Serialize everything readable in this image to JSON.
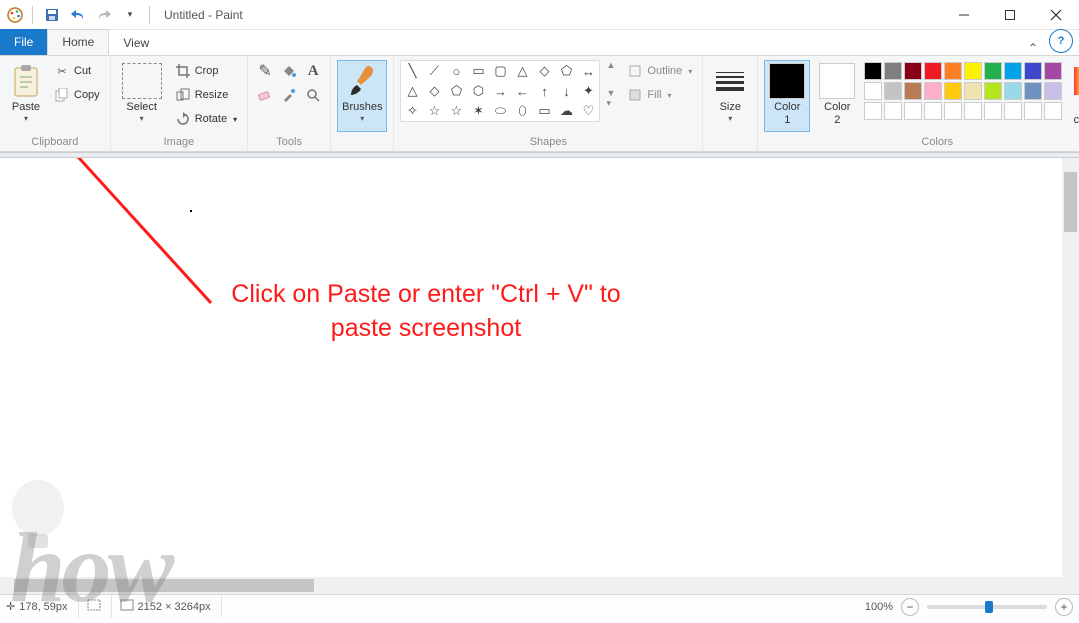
{
  "title": "Untitled - Paint",
  "tabs": {
    "file": "File",
    "home": "Home",
    "view": "View"
  },
  "groups": {
    "clipboard": {
      "label": "Clipboard",
      "paste": "Paste",
      "cut": "Cut",
      "copy": "Copy"
    },
    "image": {
      "label": "Image",
      "select": "Select",
      "crop": "Crop",
      "resize": "Resize",
      "rotate": "Rotate"
    },
    "tools": {
      "label": "Tools"
    },
    "brushes": {
      "label": "Brushes",
      "brushes": "Brushes"
    },
    "shapes": {
      "label": "Shapes",
      "outline": "Outline",
      "fill": "Fill"
    },
    "size": {
      "label": "Size",
      "size": "Size"
    },
    "colors": {
      "label": "Colors",
      "color1": "Color\n1",
      "color2": "Color\n2",
      "edit": "Edit\ncolors"
    }
  },
  "palette": [
    "#000000",
    "#7f7f7f",
    "#880015",
    "#ed1c24",
    "#ff7f27",
    "#fff200",
    "#22b14c",
    "#00a2e8",
    "#3f48cc",
    "#a349a4",
    "#ffffff",
    "#c3c3c3",
    "#b97a57",
    "#ffaec9",
    "#ffc90e",
    "#efe4b0",
    "#b5e61d",
    "#99d9ea",
    "#7092be",
    "#c8bfe7",
    "#ffffff",
    "#ffffff",
    "#ffffff",
    "#ffffff",
    "#ffffff",
    "#ffffff",
    "#ffffff",
    "#ffffff",
    "#ffffff",
    "#ffffff"
  ],
  "annotation": {
    "line1": "Click on Paste or enter \"Ctrl + V\" to",
    "line2": "paste screenshot"
  },
  "status": {
    "cursor_pos": "178, 59px",
    "canvas_size": "2152 × 3264px",
    "zoom": "100%"
  },
  "watermark": "how"
}
